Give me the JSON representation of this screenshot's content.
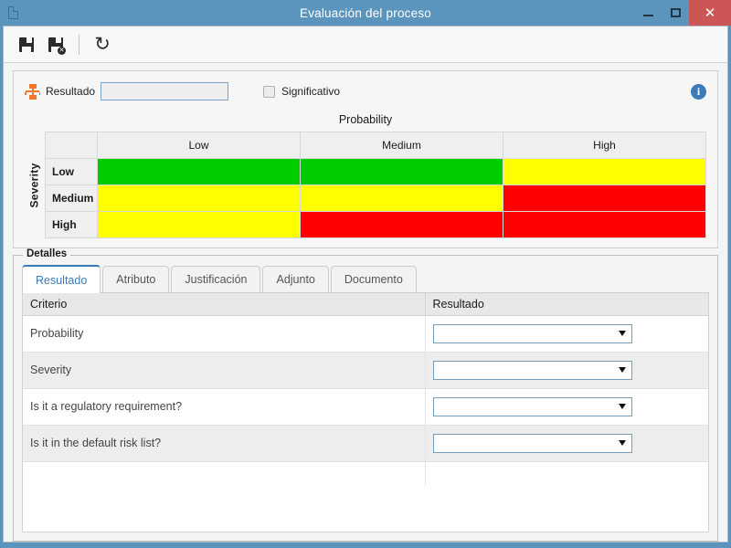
{
  "window": {
    "title": "Evaluación del proceso",
    "icon": "document-icon",
    "controls": {
      "minimize": "–",
      "maximize": "□",
      "close": "✕"
    }
  },
  "toolbar": {
    "buttons": [
      {
        "name": "save-button",
        "icon": "floppy-disk-icon",
        "label": ""
      },
      {
        "name": "save-and-close-button",
        "icon": "floppy-disk-cancel-icon",
        "label": ""
      },
      {
        "name": "refresh-button",
        "icon": "refresh-icon",
        "label": "↻"
      }
    ]
  },
  "top_panel": {
    "result_icon": "hierarchy-icon",
    "result_label": "Resultado",
    "result_value": "",
    "result_placeholder": "",
    "significant_label": "Significativo",
    "significant_checked": false,
    "info_icon": "info-icon",
    "info_glyph": "i"
  },
  "matrix": {
    "title": "Probability",
    "row_axis_label": "Severity",
    "corner": "",
    "columns": [
      "Low",
      "Medium",
      "High"
    ],
    "rows": [
      "Low",
      "Medium",
      "High"
    ],
    "cells": [
      [
        "green",
        "green",
        "yellow"
      ],
      [
        "yellow",
        "yellow",
        "red"
      ],
      [
        "yellow",
        "red",
        "red"
      ]
    ],
    "colors": {
      "green": "#00CC00",
      "yellow": "#FFFF00",
      "red": "#FF0000"
    }
  },
  "details": {
    "group_title": "Detalles",
    "tabs": [
      {
        "label": "Resultado",
        "active": true
      },
      {
        "label": "Atributo",
        "active": false
      },
      {
        "label": "Justificación",
        "active": false
      },
      {
        "label": "Adjunto",
        "active": false
      },
      {
        "label": "Documento",
        "active": false
      }
    ],
    "table": {
      "headers": [
        "Criterio",
        "Resultado"
      ],
      "rows": [
        {
          "criterio": "Probability",
          "resultado": ""
        },
        {
          "criterio": "Severity",
          "resultado": ""
        },
        {
          "criterio": "Is it a regulatory requirement?",
          "resultado": ""
        },
        {
          "criterio": "Is it in the default risk list?",
          "resultado": ""
        }
      ]
    }
  },
  "accent_colors": {
    "titlebar": "#5B94BD",
    "close_button": "#CC5555",
    "tab_active_text": "#3B7CB8",
    "hierarchy_icon": "#F0772B",
    "info_icon": "#3B7CB8"
  }
}
